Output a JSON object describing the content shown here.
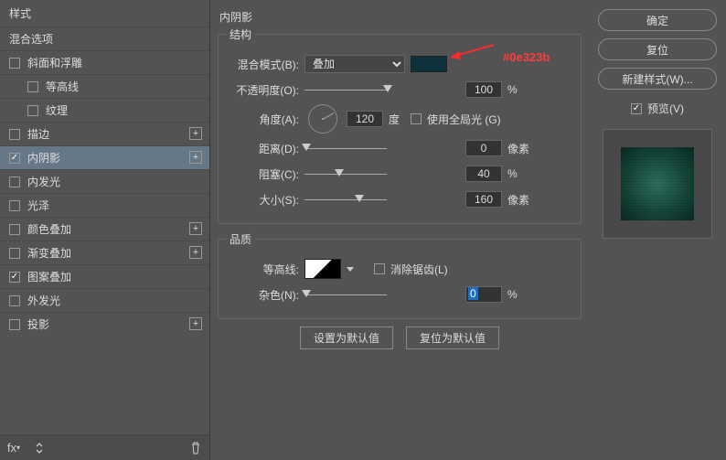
{
  "sidebar": {
    "header": "样式",
    "blendingOptions": "混合选项",
    "items": [
      {
        "label": "斜面和浮雕",
        "checked": false,
        "plus": false,
        "indent": false
      },
      {
        "label": "等高线",
        "checked": false,
        "plus": false,
        "indent": true
      },
      {
        "label": "纹理",
        "checked": false,
        "plus": false,
        "indent": true
      },
      {
        "label": "描边",
        "checked": false,
        "plus": true,
        "indent": false
      },
      {
        "label": "内阴影",
        "checked": true,
        "plus": true,
        "indent": false,
        "selected": true
      },
      {
        "label": "内发光",
        "checked": false,
        "plus": false,
        "indent": false
      },
      {
        "label": "光泽",
        "checked": false,
        "plus": false,
        "indent": false
      },
      {
        "label": "颜色叠加",
        "checked": false,
        "plus": true,
        "indent": false
      },
      {
        "label": "渐变叠加",
        "checked": false,
        "plus": true,
        "indent": false
      },
      {
        "label": "图案叠加",
        "checked": true,
        "plus": false,
        "indent": false
      },
      {
        "label": "外发光",
        "checked": false,
        "plus": false,
        "indent": false
      },
      {
        "label": "投影",
        "checked": false,
        "plus": true,
        "indent": false
      }
    ]
  },
  "main": {
    "panelTitle": "内阴影",
    "structure": {
      "legend": "结构",
      "blendModeLabel": "混合模式(B):",
      "blendModeValue": "叠加",
      "swatchColor": "#0e323b",
      "opacityLabel": "不透明度(O):",
      "opacityValue": "100",
      "opacityUnit": "%",
      "angleLabel": "角度(A):",
      "angleValue": "120",
      "angleUnit": "度",
      "globalLightLabel": "使用全局光 (G)",
      "distanceLabel": "距离(D):",
      "distanceValue": "0",
      "distanceUnit": "像素",
      "chokeLabel": "阻塞(C):",
      "chokeValue": "40",
      "chokeUnit": "%",
      "sizeLabel": "大小(S):",
      "sizeValue": "160",
      "sizeUnit": "像素"
    },
    "quality": {
      "legend": "品质",
      "contourLabel": "等高线:",
      "antiAliasLabel": "消除锯齿(L)",
      "noiseLabel": "杂色(N):",
      "noiseValue": "0",
      "noiseUnit": "%"
    },
    "defaultBtn": "设置为默认值",
    "resetBtn": "复位为默认值",
    "annotation": "#0e323b"
  },
  "right": {
    "ok": "确定",
    "cancel": "复位",
    "newStyle": "新建样式(W)...",
    "previewLabel": "预览(V)"
  }
}
